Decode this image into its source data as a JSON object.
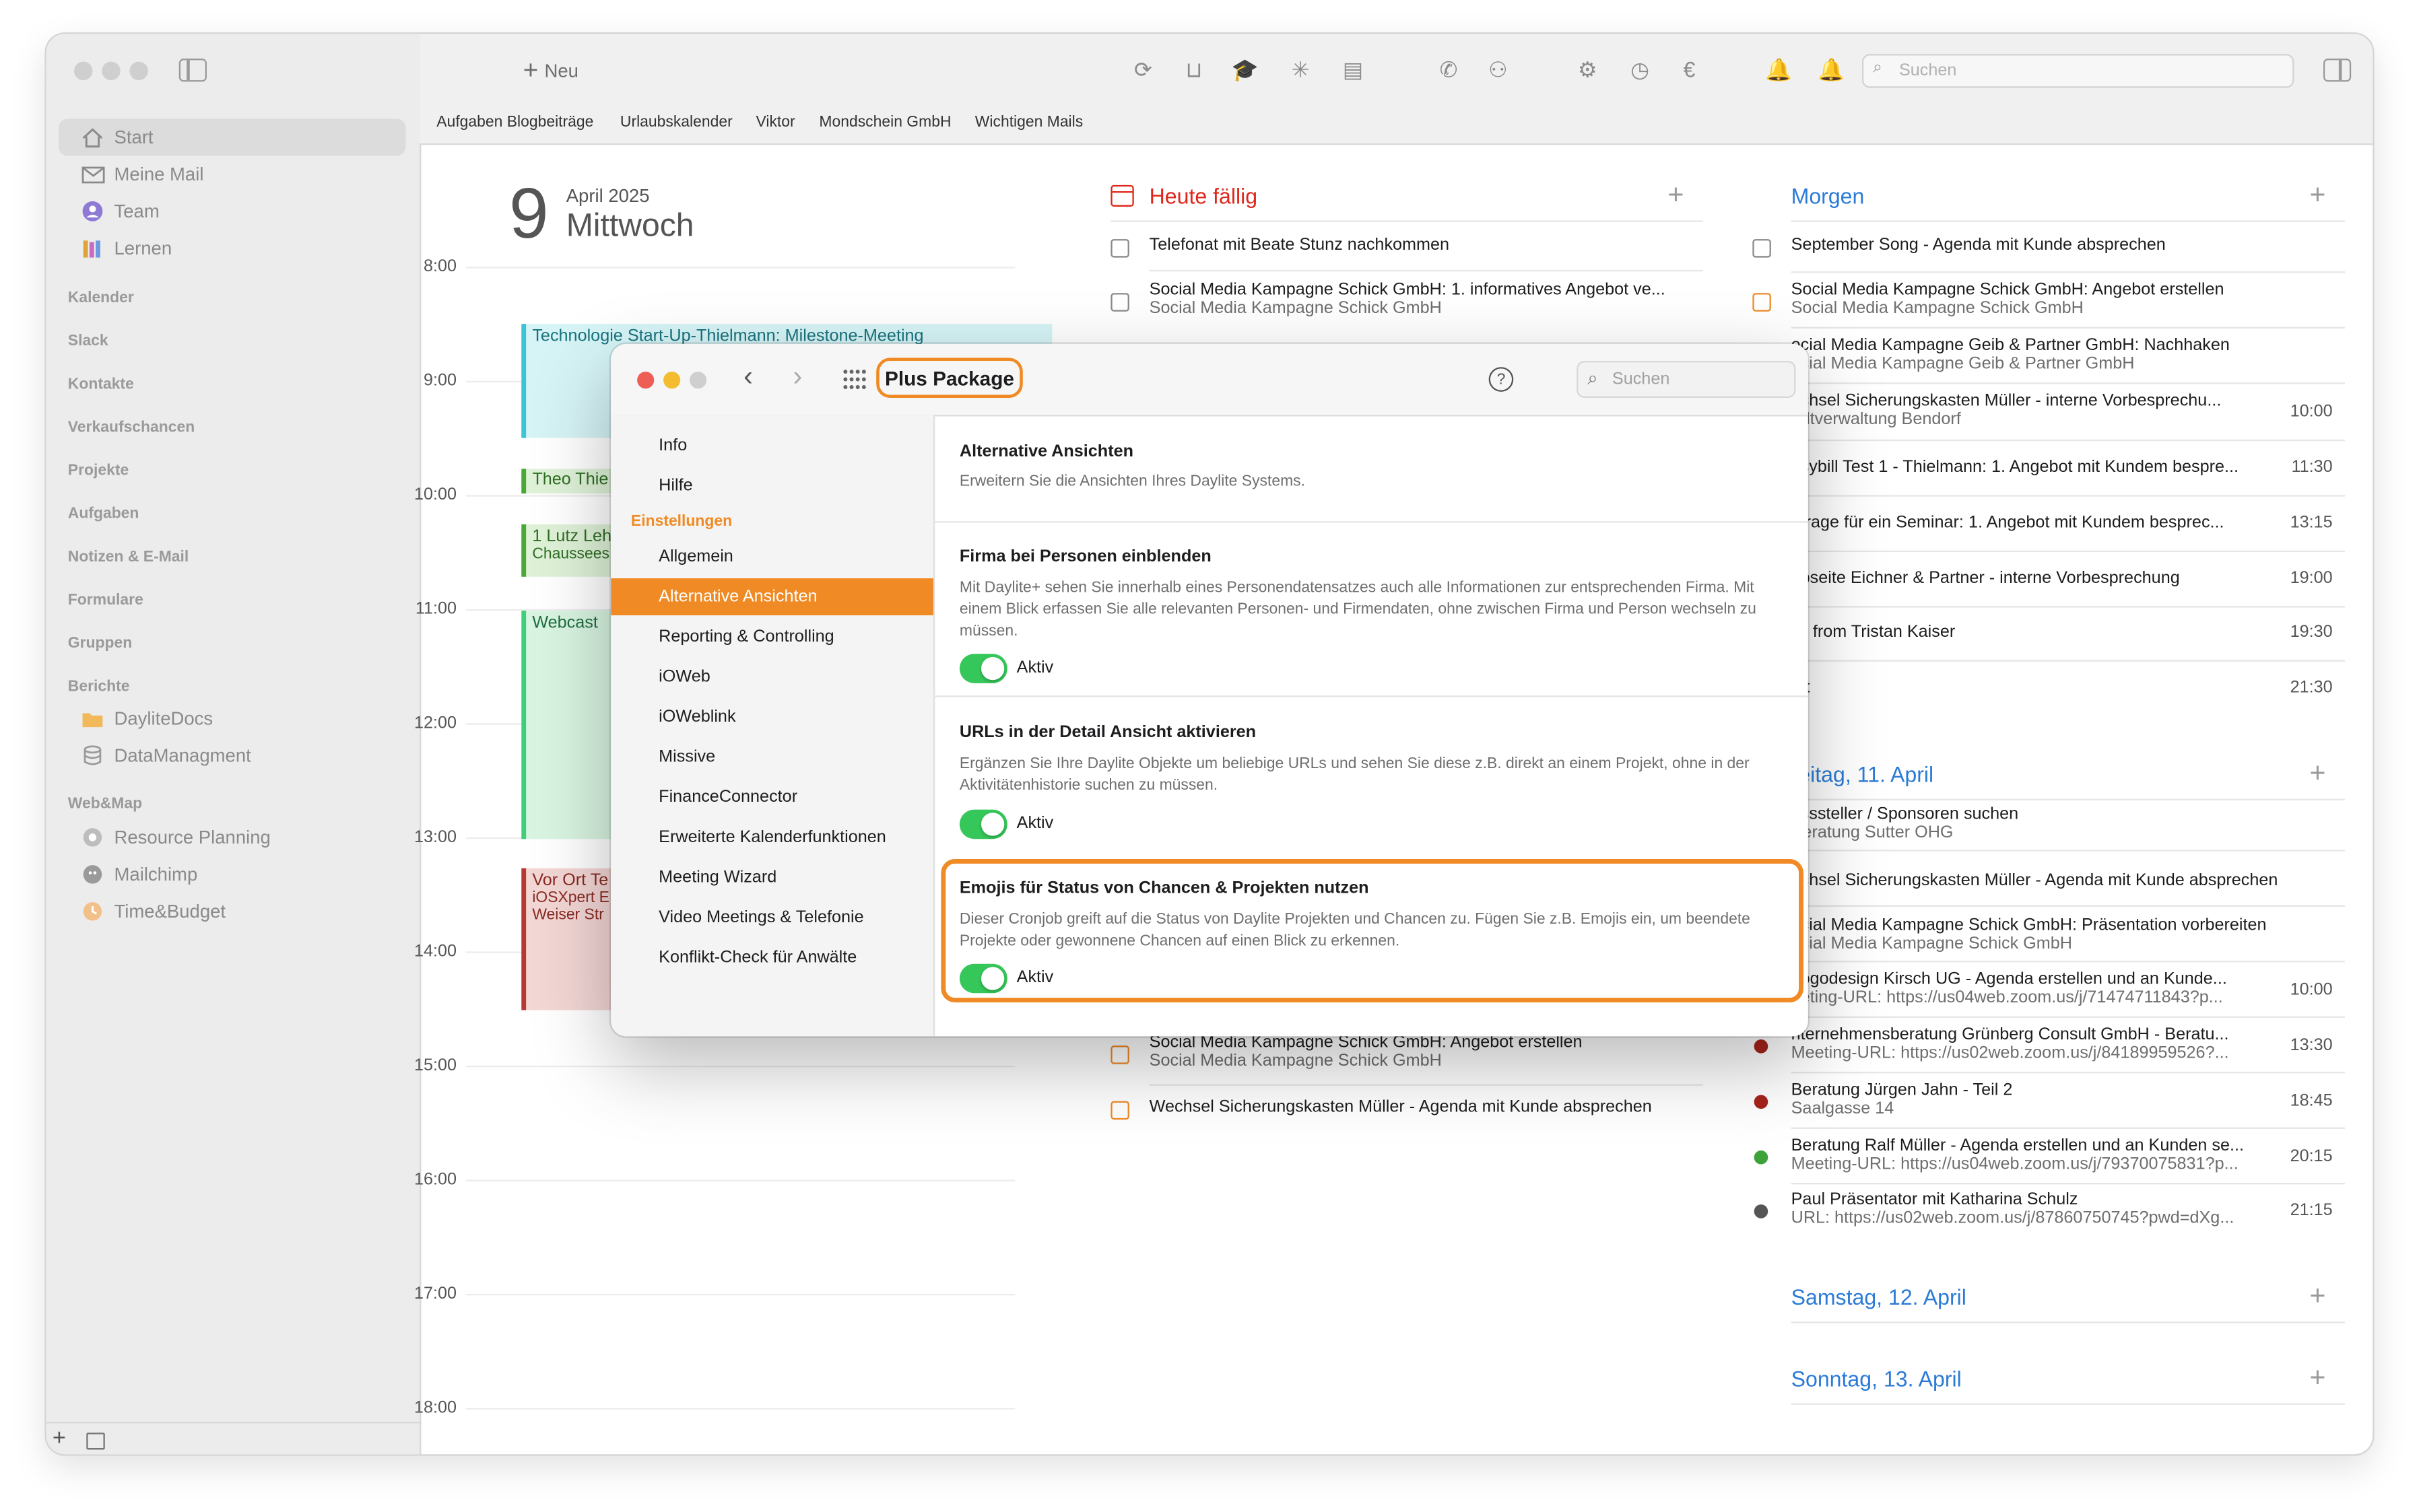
{
  "toolbar": {
    "new_label": "Neu",
    "search_placeholder": "Suchen"
  },
  "favorites": [
    "Aufgaben Blogbeiträge",
    "Urlaubskalender",
    "Viktor",
    "Mondschein GmbH",
    "Wichtigen Mails"
  ],
  "sidebar": {
    "top_items": [
      {
        "label": "Start",
        "icon": "home-icon"
      },
      {
        "label": "Meine Mail",
        "icon": "mail-icon"
      },
      {
        "label": "Team",
        "icon": "team-icon"
      },
      {
        "label": "Lernen",
        "icon": "books-icon"
      }
    ],
    "sections": [
      "Kalender",
      "Slack",
      "Kontakte",
      "Verkaufschancen",
      "Projekte",
      "Aufgaben",
      "Notizen & E-Mail",
      "Formulare",
      "Gruppen",
      "Berichte"
    ],
    "berichte_items": [
      "DayliteDocs",
      "DataManagment"
    ],
    "webmap_label": "Web&Map",
    "webmap_items": [
      "Resource Planning",
      "Mailchimp",
      "Time&Budget"
    ]
  },
  "calendar": {
    "day_number": "9",
    "month_year": "April 2025",
    "weekday": "Mittwoch",
    "hours": [
      "8:00",
      "9:00",
      "10:00",
      "11:00",
      "12:00",
      "13:00",
      "14:00",
      "15:00",
      "16:00",
      "17:00",
      "18:00"
    ],
    "events": {
      "ev1_title": "Technologie Start-Up-Thielmann: Milestone-Meeting",
      "ev2_title": "Theo Thie",
      "ev3_title": "1 Lutz Leh",
      "ev3_sub": "Chaussees",
      "ev4_title": "Webcast",
      "ev5_title": "Vor Ort Te",
      "ev5_sub1": "iOSXpert E",
      "ev5_sub2": "Weiser Str"
    }
  },
  "heute": {
    "title": "Heute fällig",
    "t1": "Telefonat mit Beate Stunz nachkommen",
    "t2": "Social Media Kampagne Schick GmbH: 1. informatives Angebot ve...",
    "t2_sub": "Social Media Kampagne Schick GmbH",
    "t3": "Social Media Kampagne Schick GmbH: Angebot erstellen",
    "t3_sub": "Social Media Kampagne Schick GmbH",
    "t4": "Wechsel Sicherungskasten Müller - Agenda mit Kunde absprechen"
  },
  "morgen": {
    "title": "Morgen",
    "items": [
      {
        "title": "September Song - Agenda mit Kunde absprechen",
        "sub": "",
        "time": ""
      },
      {
        "title": "Social Media Kampagne Schick GmbH: Angebot erstellen",
        "sub": "Social Media Kampagne Schick GmbH",
        "time": ""
      },
      {
        "title": "ocial Media Kampagne Geib & Partner GmbH: Nachhaken",
        "sub": "ocial Media Kampagne Geib & Partner GmbH",
        "time": ""
      },
      {
        "title": "echsel Sicherungskasten Müller - interne Vorbesprechu...",
        "sub": "adtverwaltung Bendorf",
        "time": "10:00"
      },
      {
        "title": "asybill Test 1 - Thielmann: 1. Angebot mit Kundem bespre...",
        "sub": "",
        "time": "11:30"
      },
      {
        "title": "nfrage für ein Seminar: 1. Angebot mit Kundem besprec...",
        "sub": "",
        "time": "13:15"
      },
      {
        "title": "ebseite Eichner & Partner - interne Vorbesprechung",
        "sub": "",
        "time": "19:00"
      },
      {
        "title": "all from Tristan Kaiser",
        "sub": "",
        "time": "19:30"
      },
      {
        "title": "rzt",
        "sub": "",
        "time": "21:30"
      }
    ]
  },
  "freitag": {
    "title": "reitag, 11. April",
    "items": [
      {
        "title": "usssteller / Sponsoren suchen",
        "sub": "Beratung Sutter OHG",
        "time": ""
      },
      {
        "title": "echsel Sicherungskasten Müller - Agenda mit Kunde absprechen",
        "sub": "",
        "time": ""
      },
      {
        "title": "ocial Media Kampagne Schick GmbH: Präsentation vorbereiten",
        "sub": "ocial Media Kampagne Schick GmbH",
        "time": ""
      },
      {
        "title": "Logodesign Kirsch UG - Agenda erstellen und an Kunde...",
        "sub": "eeting-URL: https://us04web.zoom.us/j/71474711843?p...",
        "time": "10:00"
      },
      {
        "title": "nternehmensberatung Grünberg Consult GmbH - Beratu...",
        "sub": "Meeting-URL: https://us02web.zoom.us/j/84189959526?...",
        "time": "13:30"
      },
      {
        "title": "Beratung Jürgen Jahn - Teil 2",
        "sub": "Saalgasse 14",
        "time": "18:45"
      },
      {
        "title": "Beratung Ralf Müller - Agenda erstellen und an Kunden se...",
        "sub": "Meeting-URL: https://us04web.zoom.us/j/79370075831?p...",
        "time": "20:15"
      },
      {
        "title": "Paul Präsentator mit Katharina Schulz",
        "sub": "URL: https://us02web.zoom.us/j/87860750745?pwd=dXg...",
        "time": "21:15"
      }
    ]
  },
  "samstag": {
    "title": "Samstag, 12. April"
  },
  "sonntag": {
    "title": "Sonntag, 13. April"
  },
  "modal": {
    "title": "Plus Package",
    "search_placeholder": "Suchen",
    "nav": [
      "Info",
      "Hilfe"
    ],
    "settings_label": "Einstellungen",
    "settings_items": [
      "Allgemein",
      "Alternative Ansichten",
      "Reporting & Controlling",
      "iOWeb",
      "iOWeblink",
      "Missive",
      "FinanceConnector",
      "Erweiterte Kalenderfunktionen",
      "Meeting Wizard",
      "Video Meetings & Telefonie",
      "Konflikt-Check für Anwälte"
    ],
    "selected": "Alternative Ansichten",
    "sections": [
      {
        "title": "Alternative Ansichten",
        "desc": "Erweitern Sie die Ansichten Ihres Daylite Systems.",
        "toggle": ""
      },
      {
        "title": "Firma bei Personen einblenden",
        "desc": "Mit Daylite+ sehen Sie innerhalb eines Personendatensatzes auch alle Informationen zur entsprechenden Firma. Mit einem Blick erfassen Sie alle relevanten Personen- und Firmendaten, ohne zwischen Firma und Person wechseln zu müssen.",
        "toggle": "Aktiv"
      },
      {
        "title": "URLs in der Detail Ansicht aktivieren",
        "desc": "Ergänzen Sie Ihre Daylite Objekte um beliebige URLs und sehen Sie diese z.B. direkt an einem Projekt, ohne in der Aktivitätenhistorie suchen zu müssen.",
        "toggle": "Aktiv"
      },
      {
        "title": "Emojis für Status von Chancen & Projekten nutzen",
        "desc": "Dieser Cronjob greift auf die Status von Daylite Projekten und Chancen zu. Fügen Sie z.B. Emojis ein, um beendete Projekte oder gewonnene Chancen auf einen Blick zu erkennen.",
        "toggle": "Aktiv"
      }
    ]
  },
  "colors": {
    "accent_orange": "#f08a24",
    "blue": "#2b7bd6",
    "red": "#e0261a",
    "green": "#35c759"
  }
}
